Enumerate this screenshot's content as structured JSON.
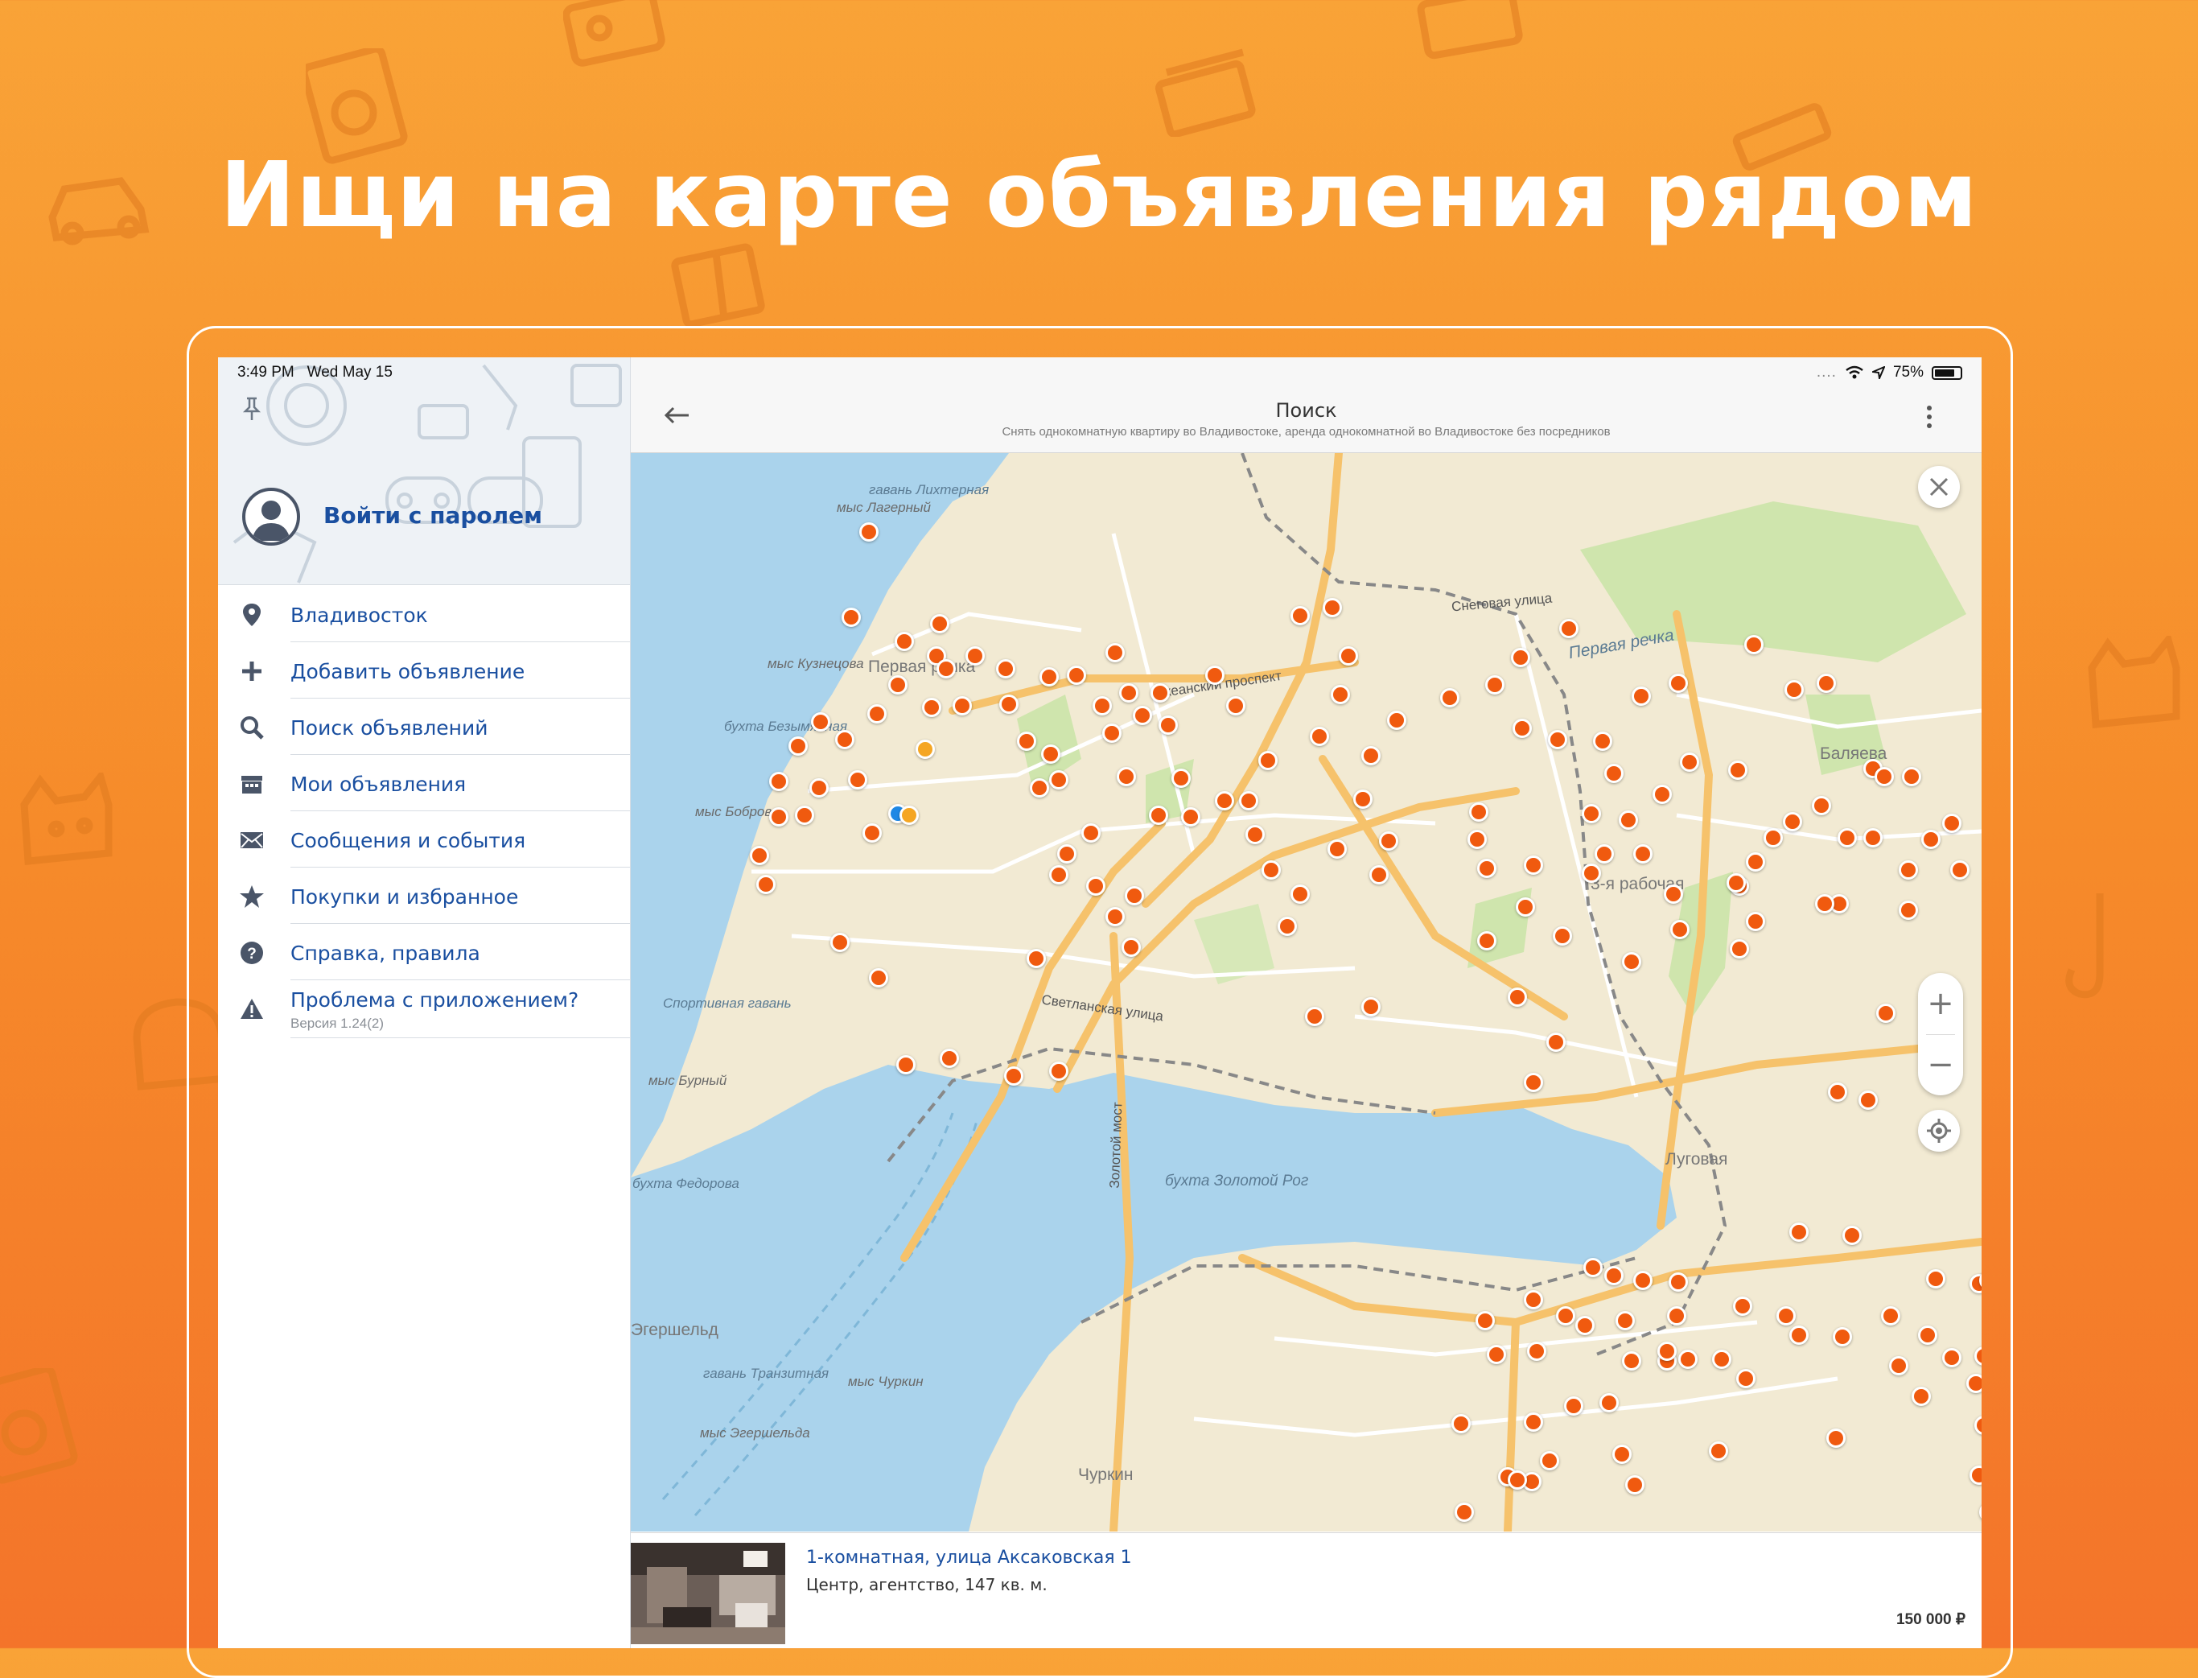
{
  "headline": "Ищи на карте объявления рядом",
  "status_bar": {
    "time": "3:49 PM",
    "date": "Wed May 15",
    "battery": "75%"
  },
  "sidebar": {
    "login_label": "Войти с паролем",
    "items": [
      {
        "label": "Владивосток",
        "icon": "location-pin-icon"
      },
      {
        "label": "Добавить объявление",
        "icon": "plus-icon"
      },
      {
        "label": "Поиск объявлений",
        "icon": "search-icon"
      },
      {
        "label": "Мои объявления",
        "icon": "store-icon"
      },
      {
        "label": "Сообщения и события",
        "icon": "envelope-icon"
      },
      {
        "label": "Покупки и избранное",
        "icon": "star-icon"
      },
      {
        "label": "Справка, правила",
        "icon": "help-icon"
      },
      {
        "label": "Проблема с приложением?",
        "icon": "warning-icon",
        "sub": "Версия 1.24(2)"
      }
    ]
  },
  "nav": {
    "title": "Поиск",
    "subtitle": "Снять однокомнатную квартиру во Владивостоке, аренда однокомнатной во Владивостоке без посредников"
  },
  "map": {
    "labels": {
      "l1": "гавань Лихтерная",
      "l2": "мыс Лагерный",
      "l3": "мыс Кузнецова",
      "l4": "Первая речка",
      "l5": "бухта Безымянная",
      "l6": "мыс Боброва",
      "l7": "Спортивная гавань",
      "l8": "мыс Бурный",
      "l9": "бухта Федорова",
      "l10": "бухта Золотой Рог",
      "l11": "гавань Транзитная",
      "l12": "мыс Чуркин",
      "l13": "мыс Эгершельда",
      "l14": "Баляева",
      "l15": "3-я рабочая",
      "l16": "Луговая",
      "l17": "Светланская улица",
      "l18": "Золотой мост",
      "l19": "Чуркин",
      "l20": "Океанский проспект",
      "l21": "Снеговая улица",
      "l22": "Первая речка",
      "l23": "Эгершельд"
    }
  },
  "listing": {
    "title": "1-комнатная, улица Аксаковская 1",
    "desc": "Центр, агентство, 147 кв. м.",
    "price": "150 000 ₽"
  }
}
